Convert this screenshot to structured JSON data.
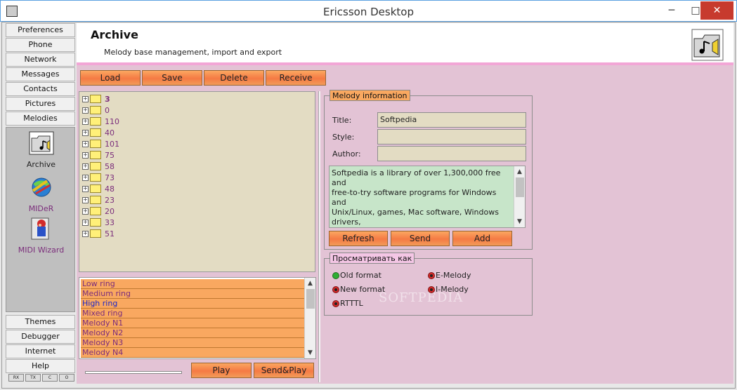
{
  "window": {
    "title": "Ericsson Desktop",
    "minimize": "─",
    "maximize": "□",
    "close": "✕"
  },
  "nav": {
    "top_items": [
      "Preferences",
      "Phone",
      "Network",
      "Messages",
      "Contacts",
      "Pictures",
      "Melodies"
    ],
    "panel_items": [
      {
        "label": "Archive",
        "icon": "archive-folder-icon"
      },
      {
        "label": "MIDeR",
        "icon": "mider-icon"
      },
      {
        "label": "MIDI Wizard",
        "icon": "midi-wizard-icon"
      }
    ],
    "bottom_items": [
      "Themes",
      "Debugger",
      "Internet",
      "Help"
    ],
    "indicators": [
      "RX",
      "TX",
      "C",
      "O"
    ]
  },
  "header": {
    "title": "Archive",
    "subtitle": "Melody base management, import and export",
    "icon": "melody-folder-icon"
  },
  "toolbar": {
    "load": "Load",
    "save": "Save",
    "delete": "Delete",
    "receive": "Receive"
  },
  "tree": {
    "items": [
      "3",
      "0",
      "110",
      "40",
      "101",
      "75",
      "58",
      "73",
      "48",
      "23",
      "20",
      "33",
      "51"
    ]
  },
  "ringtones": {
    "items": [
      "Low ring",
      "Medium ring",
      "High ring",
      "Mixed ring",
      "Melody N1",
      "Melody N2",
      "Melody N3",
      "Melody N4"
    ],
    "selected": "High ring"
  },
  "playback": {
    "play": "Play",
    "send_play": "Send&Play"
  },
  "melody_info": {
    "group_label": "Melody information",
    "title_label": "Title:",
    "title_value": "Softpedia",
    "style_label": "Style:",
    "style_value": "",
    "author_label": "Author:",
    "author_value": "",
    "description": "Softpedia is a library of over 1,300,000 free and\nfree-to-try software programs for Windows and\nUnix/Linux, games, Mac software, Windows drivers,\nmobile devices and IT-related articles.\n\nWe review and categorize these products in order to",
    "refresh": "Refresh",
    "send": "Send",
    "add": "Add"
  },
  "view_as": {
    "group_label": "Просматривать как",
    "options": [
      "Old format",
      "New format",
      "RTTTL",
      "E-Melody",
      "I-Melody"
    ],
    "selected": "Old format"
  },
  "watermark": "SOFTPEDIA",
  "colors": {
    "accent_orange": "#f57a44",
    "panel_pink": "#e3c3d5",
    "tree_bg": "#e3dcc3",
    "desc_bg": "#c7e5c9",
    "label_purple": "#7b2d7b",
    "selected_blue": "#1d27c7"
  }
}
